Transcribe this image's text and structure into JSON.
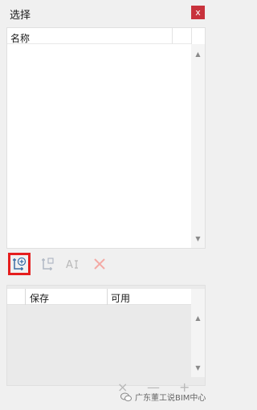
{
  "window": {
    "title": "选择",
    "close_label": "x"
  },
  "top_list": {
    "column_name": "名称"
  },
  "toolbar": {
    "buttons": [
      {
        "name": "add-selection-icon",
        "highlighted": true
      },
      {
        "name": "edit-selection-icon",
        "highlighted": false
      },
      {
        "name": "rename-selection-icon",
        "highlighted": false
      },
      {
        "name": "delete-selection-icon",
        "highlighted": false
      }
    ]
  },
  "bottom_table": {
    "columns": [
      "保存",
      "可用"
    ]
  },
  "bottom_actions": {
    "remove": "×",
    "minus": "—",
    "plus": "+"
  },
  "watermark": {
    "text": "广东董工说BIM中心"
  },
  "colors": {
    "highlight": "#e51e1e",
    "close_bg": "#c8323c"
  }
}
